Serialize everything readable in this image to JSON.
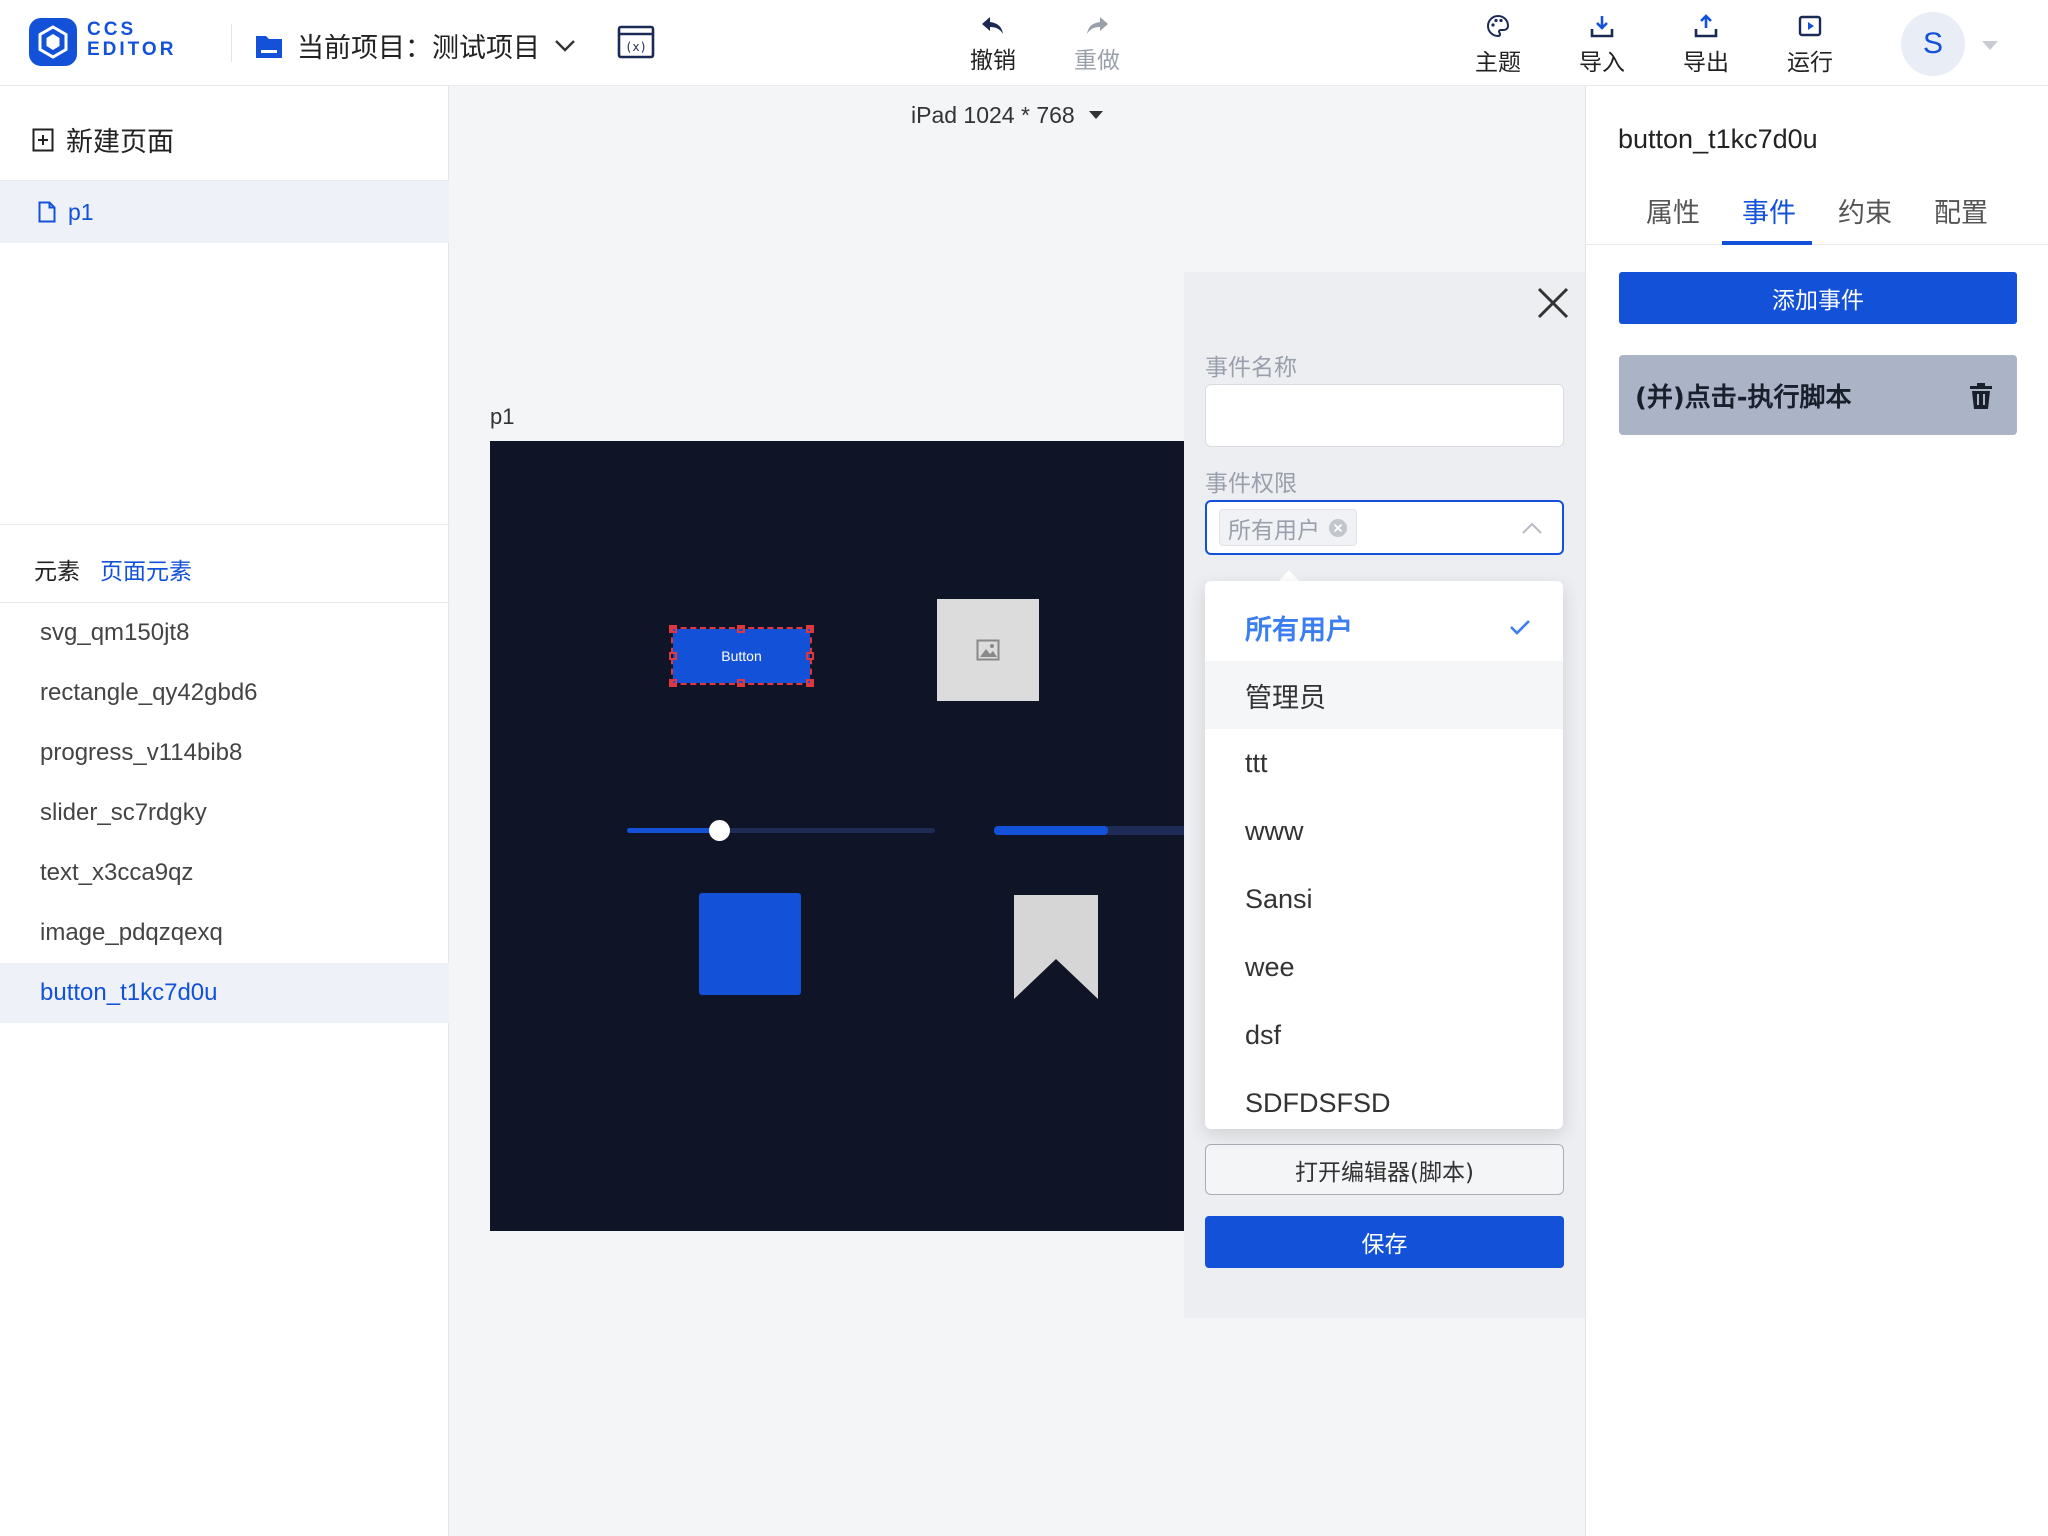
{
  "header": {
    "logo_line1": "CCS",
    "logo_line2": "EDITOR",
    "project_label": "当前项目：",
    "project_name": "测试项目",
    "toolbar": {
      "undo": "撤销",
      "redo": "重做"
    },
    "actions": {
      "theme": "主题",
      "import": "导入",
      "export": "导出",
      "run": "运行"
    },
    "avatar_initial": "S"
  },
  "left": {
    "new_page": "新建页面",
    "pages": [
      "p1"
    ],
    "tabs": {
      "elements": "元素",
      "page_elements": "页面元素"
    },
    "elements": [
      "svg_qm150jt8",
      "rectangle_qy42gbd6",
      "progress_v114bib8",
      "slider_sc7rdgky",
      "text_x3cca9qz",
      "image_pdqzqexq",
      "button_t1kc7d0u"
    ],
    "selected_element": "button_t1kc7d0u"
  },
  "center": {
    "device": "iPad 1024 * 768",
    "page_name": "p1",
    "button_text": "Button",
    "slider_value_fraction": 0.3,
    "progress_value_fraction": 0.6
  },
  "event_panel": {
    "name_label": "事件名称",
    "name_value": "",
    "permission_label": "事件权限",
    "permission_tag": "所有用户",
    "options": [
      "所有用户",
      "管理员",
      "ttt",
      "www",
      "Sansi",
      "wee",
      "dsf",
      "SDFDSFSD"
    ],
    "selected_option": "所有用户",
    "hovered_option": "管理员",
    "open_editor": "打开编辑器(脚本)",
    "save": "保存"
  },
  "right": {
    "element_name": "button_t1kc7d0u",
    "tabs": [
      "属性",
      "事件",
      "约束",
      "配置"
    ],
    "active_tab": "事件",
    "add_event": "添加事件",
    "events": [
      "(并)点击-执行脚本"
    ]
  },
  "colors": {
    "primary": "#1352d8",
    "canvas_bg": "#0f1426",
    "check": "#3b7ef0"
  }
}
